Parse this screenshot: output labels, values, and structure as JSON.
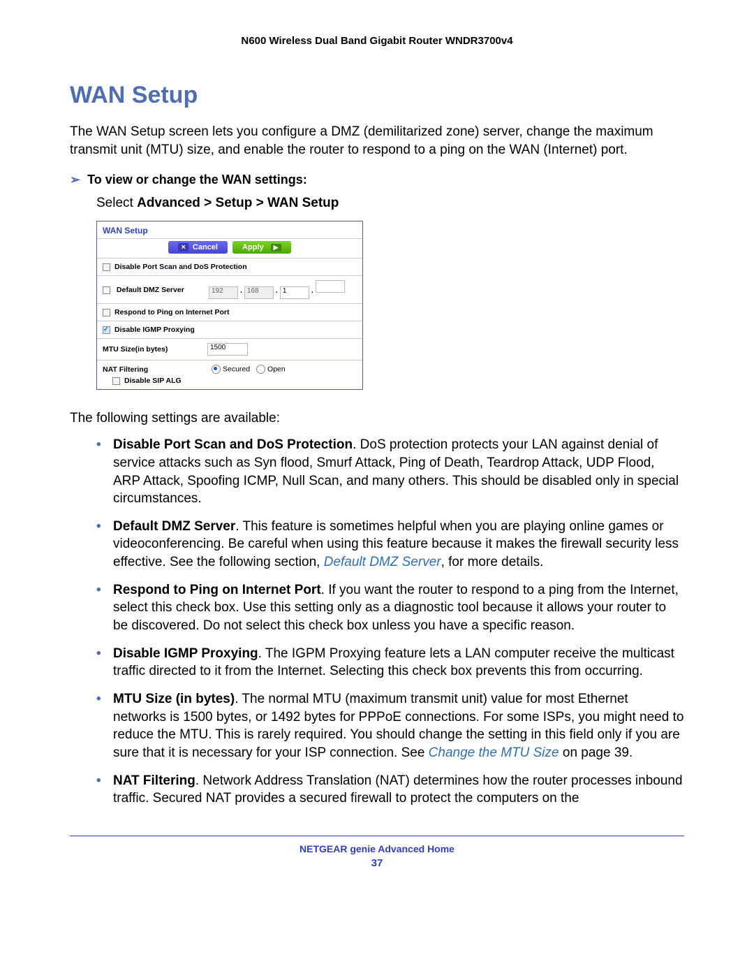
{
  "header": {
    "title": "N600 Wireless Dual Band Gigabit Router WNDR3700v4"
  },
  "section": {
    "title": "WAN Setup",
    "intro": "The WAN Setup screen lets you configure a DMZ (demilitarized zone) server, change the maximum transmit unit (MTU) size, and enable the router to respond to a ping on the WAN (Internet) port."
  },
  "task": {
    "heading": "To view or change the WAN settings:",
    "step_prefix": "Select ",
    "step_path": "Advanced > Setup > WAN Setup"
  },
  "shot": {
    "title": "WAN Setup",
    "cancel": "Cancel",
    "apply": "Apply",
    "rows": {
      "dos": "Disable Port Scan and DoS Protection",
      "dmz": "Default DMZ Server",
      "dmz_ip": {
        "a": "192",
        "b": "168",
        "c": "1",
        "d": ""
      },
      "ping": "Respond to Ping on Internet Port",
      "igmp": "Disable IGMP Proxying",
      "mtu_label": "MTU Size(in bytes)",
      "mtu_value": "1500",
      "nat_label": "NAT Filtering",
      "nat_secured": "Secured",
      "nat_open": "Open",
      "sip": "Disable SIP ALG"
    }
  },
  "settings_intro": "The following settings are available:",
  "bullets": {
    "dos": {
      "title": "Disable Port Scan and DoS Protection",
      "text": ". DoS protection protects your LAN against denial of service attacks such as Syn flood, Smurf Attack, Ping of Death, Teardrop Attack, UDP Flood, ARP Attack, Spoofing ICMP, Null Scan, and many others. This should be disabled only in special circumstances."
    },
    "dmz": {
      "title": "Default DMZ Server",
      "text_before": ". This feature is sometimes helpful when you are playing online games or videoconferencing. Be careful when using this feature because it makes the firewall security less effective. See the following section, ",
      "link": "Default DMZ Server",
      "text_after": ", for more details."
    },
    "ping": {
      "title": "Respond to Ping on Internet Port",
      "text": ". If you want the router to respond to a ping from the Internet, select this check box. Use this setting only as a diagnostic tool because it allows your router to be discovered. Do not select this check box unless you have a specific reason."
    },
    "igmp": {
      "title": "Disable IGMP Proxying",
      "text": ". The IGPM Proxying feature lets a LAN computer receive the multicast traffic directed to it from the Internet. Selecting this check box prevents this from occurring."
    },
    "mtu": {
      "title": "MTU Size (in bytes)",
      "text_before": ". The normal MTU (maximum transmit unit) value for most Ethernet networks is 1500 bytes, or 1492 bytes for PPPoE connections. For some ISPs, you might need to reduce the MTU. This is rarely required. You should change the setting in this field only if you are sure that it is necessary for your ISP connection. See ",
      "link": "Change the MTU Size",
      "text_after": " on page 39."
    },
    "nat": {
      "title": "NAT Filtering",
      "text": ". Network Address Translation (NAT) determines how the router processes inbound traffic. Secured NAT provides a secured firewall to protect the computers on the"
    }
  },
  "footer": {
    "chapter": "NETGEAR genie Advanced Home",
    "page": "37"
  }
}
